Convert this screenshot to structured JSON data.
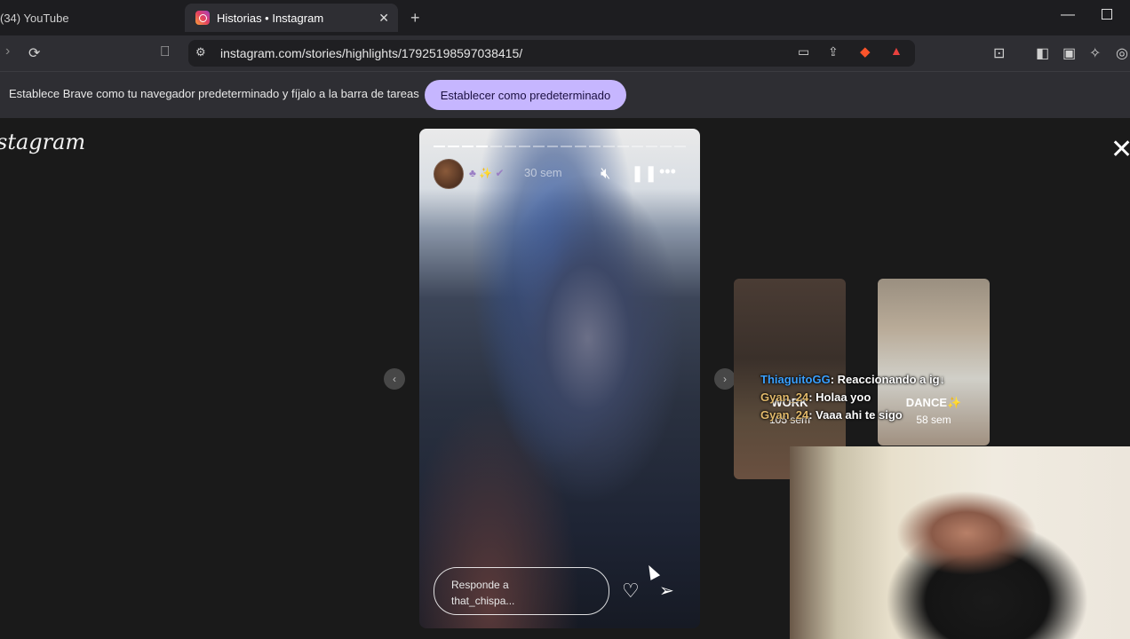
{
  "browser": {
    "tabs": [
      {
        "label": "(34) YouTube"
      },
      {
        "label": "Historias • Instagram"
      }
    ],
    "close_tab_symbol": "✕",
    "new_tab_symbol": "+",
    "url": "instagram.com/stories/highlights/17925198597038415/"
  },
  "infobar": {
    "message": "Establece Brave como tu navegador predeterminado y fíjalo a la barra de tareas",
    "button": "Establecer como predeterminado"
  },
  "instagram": {
    "logo": "stagram",
    "close_symbol": "✕"
  },
  "story": {
    "progress_total": 18,
    "progress_done": 4,
    "time": "30 sem",
    "reply_placeholder": "Responde a that_chispa...",
    "icons": [
      "muted-speaker-icon",
      "pause-icon",
      "more-icon",
      "heart-icon",
      "send-icon"
    ]
  },
  "previews": [
    {
      "label": "WORK",
      "time": "105 sem"
    },
    {
      "label": "DANCE✨",
      "time": "58 sem"
    }
  ],
  "chat": [
    {
      "user": "ThiaguitoGG",
      "text": "Reaccionando a ig↓"
    },
    {
      "user": "Gyan_24",
      "text": "Holaa yoo"
    },
    {
      "user": "Gyan_24",
      "text": "Vaaa ahi te sigo"
    }
  ],
  "colors": {
    "accent_button": "#c6b6ff",
    "chat_user1": "#3aa0ff",
    "chat_user2": "#e2b96a"
  }
}
